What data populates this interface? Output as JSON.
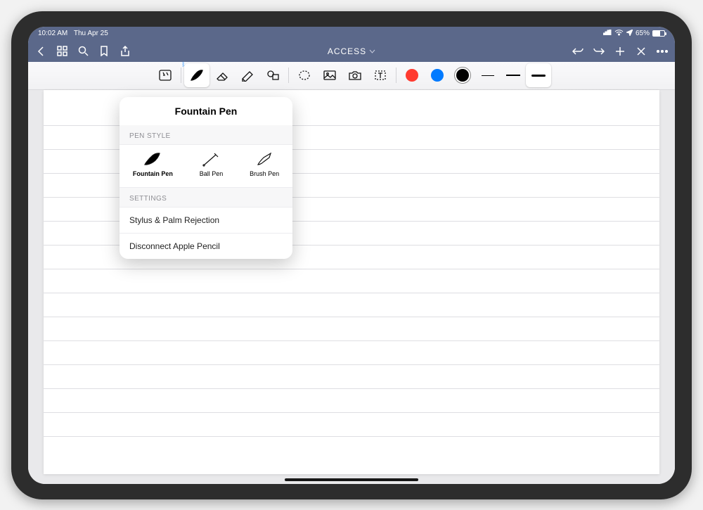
{
  "status": {
    "time": "10:02 AM",
    "date": "Thu Apr 25",
    "battery": "65%"
  },
  "navbar": {
    "title": "ACCESS"
  },
  "colors": {
    "navbar": "#5b688a",
    "accent_red": "#ff3b30",
    "accent_blue": "#007aff",
    "accent_black": "#000000"
  },
  "popover": {
    "title": "Fountain Pen",
    "section_pen_style": "PEN STYLE",
    "pen_styles": [
      {
        "label": "Fountain Pen",
        "selected": true
      },
      {
        "label": "Ball Pen",
        "selected": false
      },
      {
        "label": "Brush Pen",
        "selected": false
      }
    ],
    "section_settings": "SETTINGS",
    "rows": [
      "Stylus & Palm Rejection",
      "Disconnect Apple Pencil"
    ]
  },
  "toolbar": {
    "selected_stroke": "thick"
  }
}
